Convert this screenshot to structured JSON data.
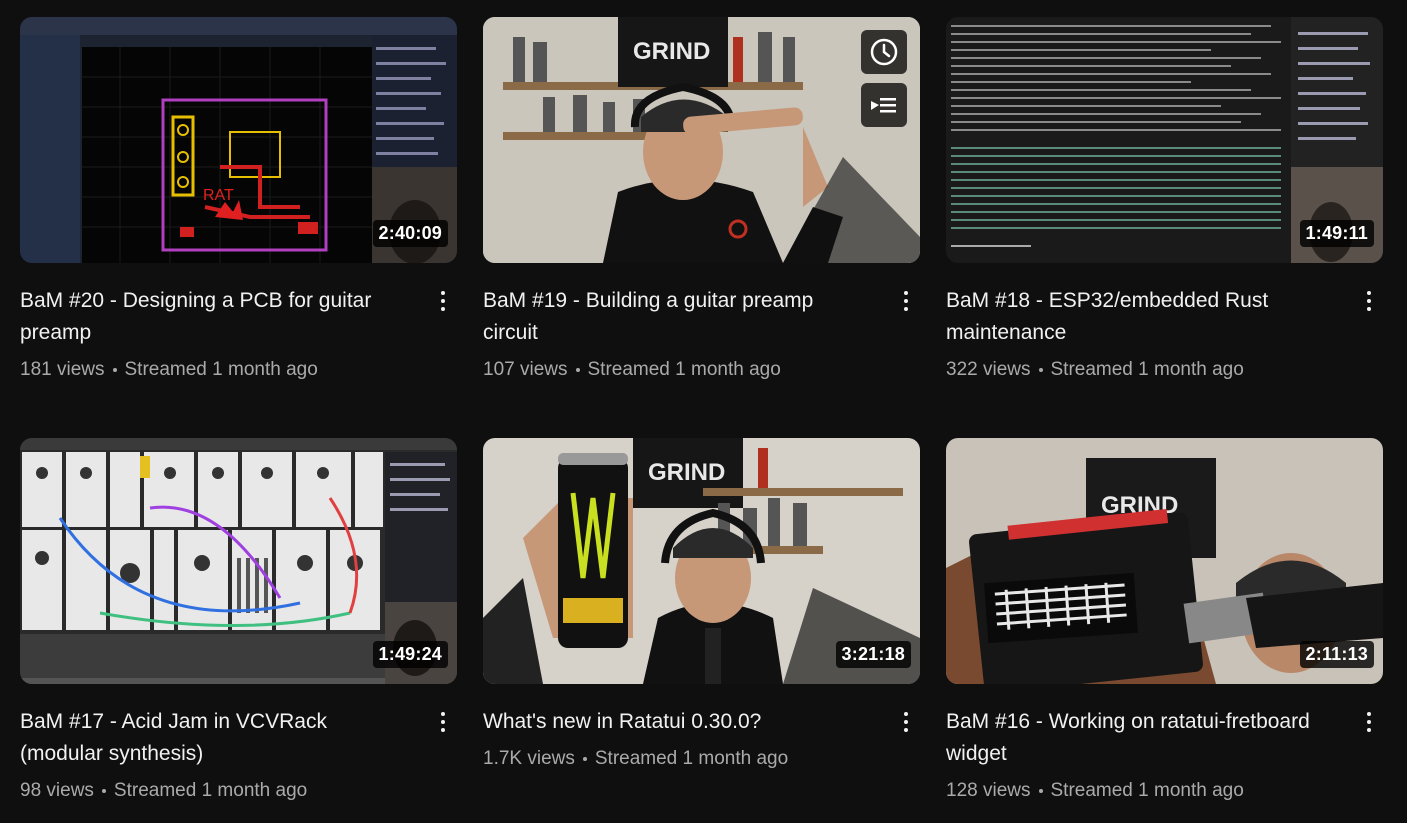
{
  "videos": [
    {
      "title": "BaM #20 - Designing a PCB for guitar preamp",
      "views": "181 views",
      "age": "Streamed 1 month ago",
      "duration": "2:40:09"
    },
    {
      "title": "BaM #19 - Building a guitar preamp circuit",
      "views": "107 views",
      "age": "Streamed 1 month ago",
      "duration": "",
      "hover_actions": [
        "clock-icon",
        "add-to-queue-icon"
      ]
    },
    {
      "title": "BaM #18 - ESP32/embedded Rust maintenance",
      "views": "322 views",
      "age": "Streamed 1 month ago",
      "duration": "1:49:11"
    },
    {
      "title": "BaM #17 - Acid Jam in VCVRack (modular synthesis)",
      "views": "98 views",
      "age": "Streamed 1 month ago",
      "duration": "1:49:24"
    },
    {
      "title": "What's new in Ratatui 0.30.0?",
      "views": "1.7K views",
      "age": "Streamed 1 month ago",
      "duration": "3:21:18"
    },
    {
      "title": "BaM #16 - Working on ratatui-fretboard widget",
      "views": "128 views",
      "age": "Streamed 1 month ago",
      "duration": "2:11:13"
    }
  ],
  "colors": {
    "background": "#0f0f0f",
    "title": "#f1f1f1",
    "meta": "#aaaaaa"
  }
}
